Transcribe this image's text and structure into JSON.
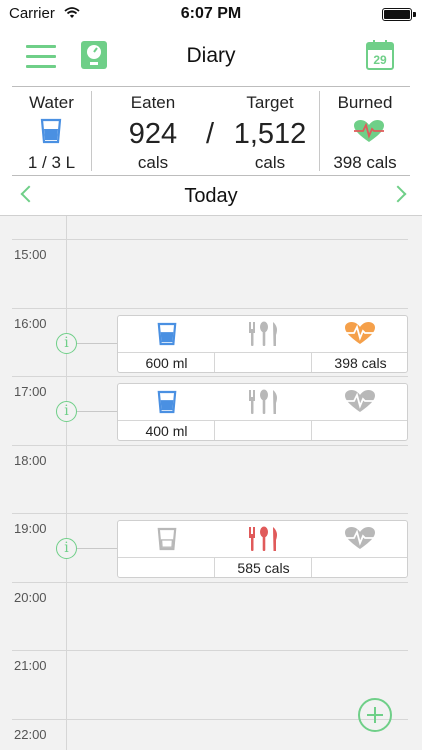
{
  "status_bar": {
    "carrier": "Carrier",
    "time": "6:07 PM"
  },
  "nav": {
    "title": "Diary",
    "calendar_day": "29"
  },
  "summary": {
    "water_label": "Water",
    "water_value": "1 / 3 L",
    "eaten_label": "Eaten",
    "eaten_value": "924",
    "eaten_unit": "cals",
    "divider": "/",
    "target_label": "Target",
    "target_value": "1,512",
    "target_unit": "cals",
    "burned_label": "Burned",
    "burned_value": "398 cals"
  },
  "day_nav": {
    "label": "Today"
  },
  "timeline": {
    "hours": [
      "15:00",
      "16:00",
      "17:00",
      "18:00",
      "19:00",
      "20:00",
      "21:00",
      "22:00"
    ],
    "entries": [
      {
        "time": "16:00",
        "water": "600 ml",
        "food": "",
        "exercise": "398 cals",
        "water_active": true,
        "food_active": false,
        "exercise_active": true
      },
      {
        "time": "17:00",
        "water": "400 ml",
        "food": "",
        "exercise": "",
        "water_active": true,
        "food_active": false,
        "exercise_active": false
      },
      {
        "time": "19:00",
        "water": "",
        "food": "585 cals",
        "exercise": "",
        "water_active": false,
        "food_active": true,
        "exercise_active": false
      }
    ]
  },
  "colors": {
    "accent": "#6fcf88",
    "water": "#4a90e2",
    "food": "#e05a5a",
    "heart": "#f5a04a",
    "inactive": "#b8b8b8"
  }
}
